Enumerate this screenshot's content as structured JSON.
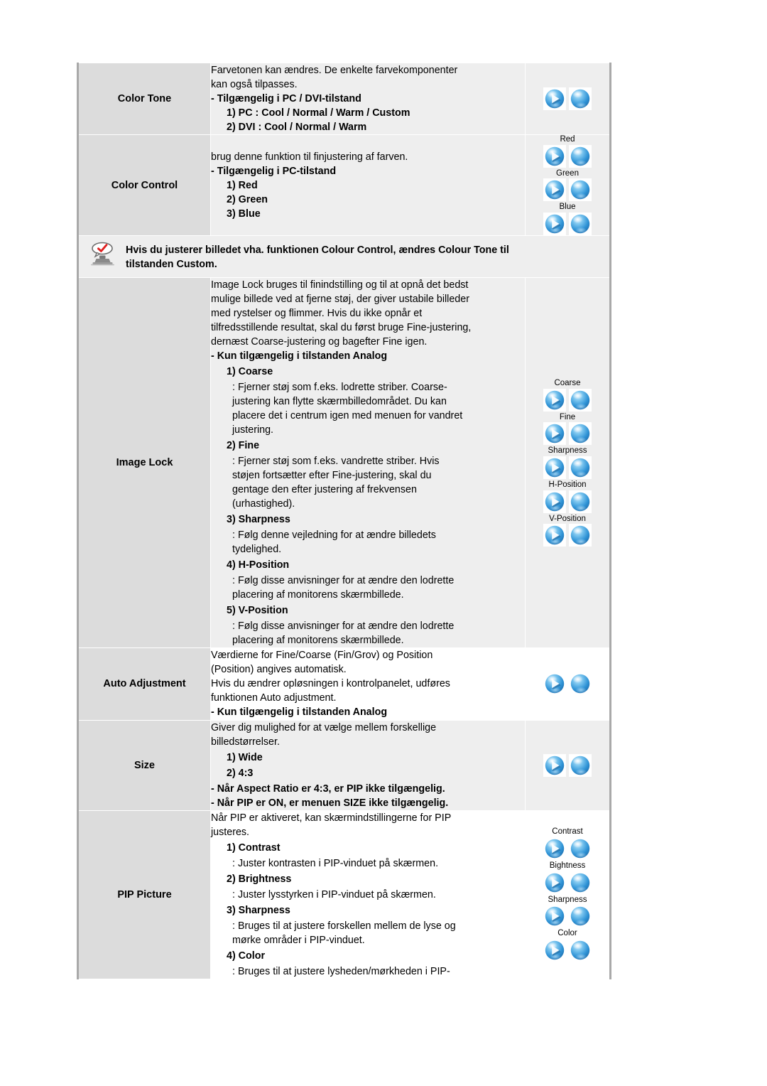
{
  "document": {
    "title": "Monitor OSD Functions",
    "language": "da"
  },
  "colors": {
    "label_bg": "#dcdcdc",
    "desc_bg": "#eeeeee",
    "white_bg": "#ffffff",
    "border": "#a9a9a9",
    "sphere_blue": "#3d9ede",
    "check_red": "#e02020"
  },
  "rows": {
    "color_tone": {
      "label": "Color Tone",
      "body": {
        "p1": "Farvetonen kan ændres. De enkelte farvekomponenter",
        "p2": "kan også tilpasses.",
        "avail": "- Tilgængelig i PC / DVI-tilstand",
        "item1": "1) PC : Cool / Normal / Warm / Custom",
        "item2": "2) DVI : Cool / Normal / Warm"
      },
      "icons": [
        {
          "caption": "",
          "type": "pair"
        }
      ]
    },
    "color_control": {
      "label": "Color Control",
      "body": {
        "p1": "brug denne funktion til finjustering af farven.",
        "avail": "- Tilgængelig i PC-tilstand",
        "item1": "1) Red",
        "item2": "2) Green",
        "item3": "3) Blue"
      },
      "icons": [
        {
          "caption": "Red",
          "type": "pair"
        },
        {
          "caption": "Green",
          "type": "pair"
        },
        {
          "caption": "Blue",
          "type": "pair"
        }
      ]
    },
    "note": {
      "icon_name": "note-monitor-icon",
      "line1": "Hvis du justerer billedet vha. funktionen Colour Control, ændres Colour Tone til",
      "line2": "tilstanden Custom."
    },
    "image_lock": {
      "label": "Image Lock",
      "body": {
        "p1": "Image Lock bruges til finindstilling og til at opnå det bedst",
        "p2": "mulige billede ved at fjerne støj, der giver ustabile billeder",
        "p3": "med rystelser og flimmer. Hvis du ikke opnår et",
        "p4": "tilfredsstillende resultat, skal du først bruge Fine-justering,",
        "p5": "dernæst Coarse-justering og bagefter Fine igen.",
        "avail": "- Kun tilgængelig i tilstanden Analog",
        "item1": "1) Coarse",
        "item1_d1": ": Fjerner støj som f.eks. lodrette striber. Coarse-",
        "item1_d2": "justering kan flytte skærmbilledområdet. Du kan",
        "item1_d3": "placere det i centrum igen med menuen for vandret",
        "item1_d4": "justering.",
        "item2": "2) Fine",
        "item2_d1": ": Fjerner støj som f.eks. vandrette striber. Hvis",
        "item2_d2": "støjen fortsætter efter Fine-justering, skal du",
        "item2_d3": "gentage den efter justering af frekvensen",
        "item2_d4": "(urhastighed).",
        "item3": "3) Sharpness",
        "item3_d1": ": Følg denne vejledning for at ændre billedets",
        "item3_d2": "tydelighed.",
        "item4": "4) H-Position",
        "item4_d1": ": Følg disse anvisninger for at ændre den lodrette",
        "item4_d2": "placering af monitorens skærmbillede.",
        "item5": "5) V-Position",
        "item5_d1": ": Følg disse anvisninger for at ændre den lodrette",
        "item5_d2": "placering af monitorens skærmbillede."
      },
      "icons": [
        {
          "caption": "Coarse",
          "type": "pair"
        },
        {
          "caption": "Fine",
          "type": "pair"
        },
        {
          "caption": "Sharpness",
          "type": "pair"
        },
        {
          "caption": "H-Position",
          "type": "pair"
        },
        {
          "caption": "V-Position",
          "type": "pair"
        }
      ]
    },
    "auto_adjustment": {
      "label": "Auto Adjustment",
      "body": {
        "p1": "Værdierne for Fine/Coarse (Fin/Grov) og Position",
        "p2": "(Position) angives automatisk.",
        "p3": "Hvis du ændrer opløsningen i kontrolpanelet, udføres",
        "p4": "funktionen Auto adjustment.",
        "avail": "- Kun tilgængelig i tilstanden Analog"
      },
      "icons": [
        {
          "caption": "",
          "type": "pair"
        }
      ]
    },
    "size": {
      "label": "Size",
      "body": {
        "p1": "Giver dig mulighed for at vælge mellem forskellige",
        "p2": "billedstørrelser.",
        "item1": "1) Wide",
        "item2": "2) 4:3",
        "note1": "- Når Aspect Ratio er 4:3, er PIP ikke tilgængelig.",
        "note2": "- Når PIP er ON, er menuen SIZE ikke tilgængelig."
      },
      "icons": [
        {
          "caption": "",
          "type": "pair"
        }
      ]
    },
    "pip_picture": {
      "label": "PIP Picture",
      "body": {
        "p1": "Når PIP er aktiveret, kan skærmindstillingerne for PIP",
        "p2": "justeres.",
        "item1": "1) Contrast",
        "item1_d1": ": Juster kontrasten i PIP-vinduet på skærmen.",
        "item2": "2) Brightness",
        "item2_d1": ": Juster lysstyrken i PIP-vinduet på skærmen.",
        "item3": "3) Sharpness",
        "item3_d1": ": Bruges til at justere forskellen mellem de lyse og",
        "item3_d2": "mørke områder i PIP-vinduet.",
        "item4": "4) Color",
        "item4_d1": ": Bruges til at justere lysheden/mørkheden i PIP-"
      },
      "icons": [
        {
          "caption": "Contrast",
          "type": "pair"
        },
        {
          "caption": "Bightness",
          "type": "pair"
        },
        {
          "caption": "Sharpness",
          "type": "pair"
        },
        {
          "caption": "Color",
          "type": "pair"
        }
      ]
    }
  },
  "icon_names": {
    "sphere_play": "play-sphere-icon",
    "sphere_plain": "plain-sphere-icon",
    "note": "note-monitor-icon"
  }
}
